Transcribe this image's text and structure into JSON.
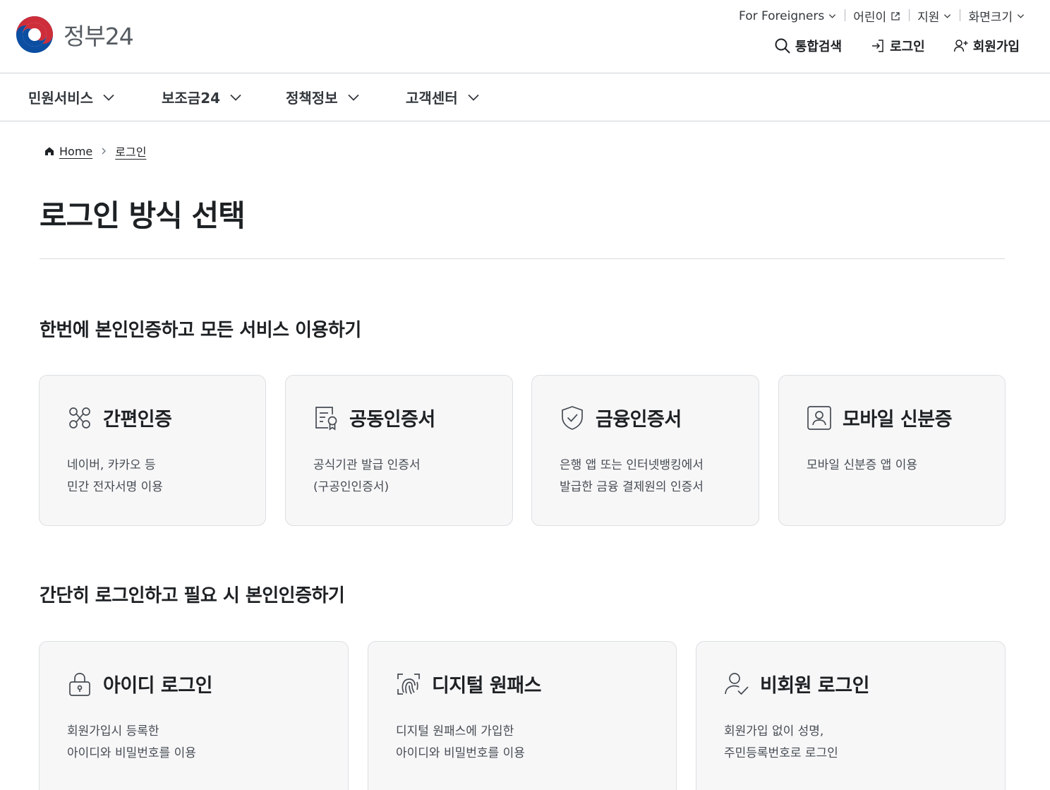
{
  "header": {
    "logo_text": "정부24",
    "util_links": [
      {
        "label": "For Foreigners",
        "icon": "chevron-down-icon"
      },
      {
        "label": "어린이",
        "icon": "external-link-icon"
      },
      {
        "label": "지원",
        "icon": "chevron-down-icon"
      },
      {
        "label": "화면크기",
        "icon": "chevron-down-icon"
      }
    ],
    "actions": {
      "search": "통합검색",
      "login": "로그인",
      "signup": "회원가입"
    }
  },
  "gnb": [
    "민원서비스",
    "보조금24",
    "정책정보",
    "고객센터"
  ],
  "breadcrumb": {
    "home": "Home",
    "current": "로그인"
  },
  "page_title": "로그인 방식 선택",
  "sections": [
    {
      "title": "한번에 본인인증하고 모든 서비스 이용하기",
      "cards": [
        {
          "icon": "simple-auth-icon",
          "title": "간편인증",
          "line1": "네이버, 카카오 등",
          "line2": "민간 전자서명 이용"
        },
        {
          "icon": "certificate-icon",
          "title": "공동인증서",
          "line1": "공식기관 발급 인증서",
          "line2": "(구공인인증서)"
        },
        {
          "icon": "shield-check-icon",
          "title": "금융인증서",
          "line1": "은행 앱 또는 인터넷뱅킹에서",
          "line2": "발급한 금융 결제원의 인증서"
        },
        {
          "icon": "id-card-icon",
          "title": "모바일 신분증",
          "line1": "모바일 신분증 앱 이용",
          "line2": ""
        }
      ]
    },
    {
      "title": "간단히 로그인하고 필요 시 본인인증하기",
      "cards": [
        {
          "icon": "lock-icon",
          "title": "아이디 로그인",
          "line1": "회원가입시 등록한",
          "line2": "아이디와 비밀번호를 이용"
        },
        {
          "icon": "fingerprint-icon",
          "title": "디지털 원패스",
          "line1": "디지털 원패스에 가입한",
          "line2": "아이디와 비밀번호를 이용"
        },
        {
          "icon": "user-check-icon",
          "title": "비회원 로그인",
          "line1": "회원가입 없이 성명,",
          "line2": "주민등록번호로 로그인"
        }
      ]
    }
  ]
}
